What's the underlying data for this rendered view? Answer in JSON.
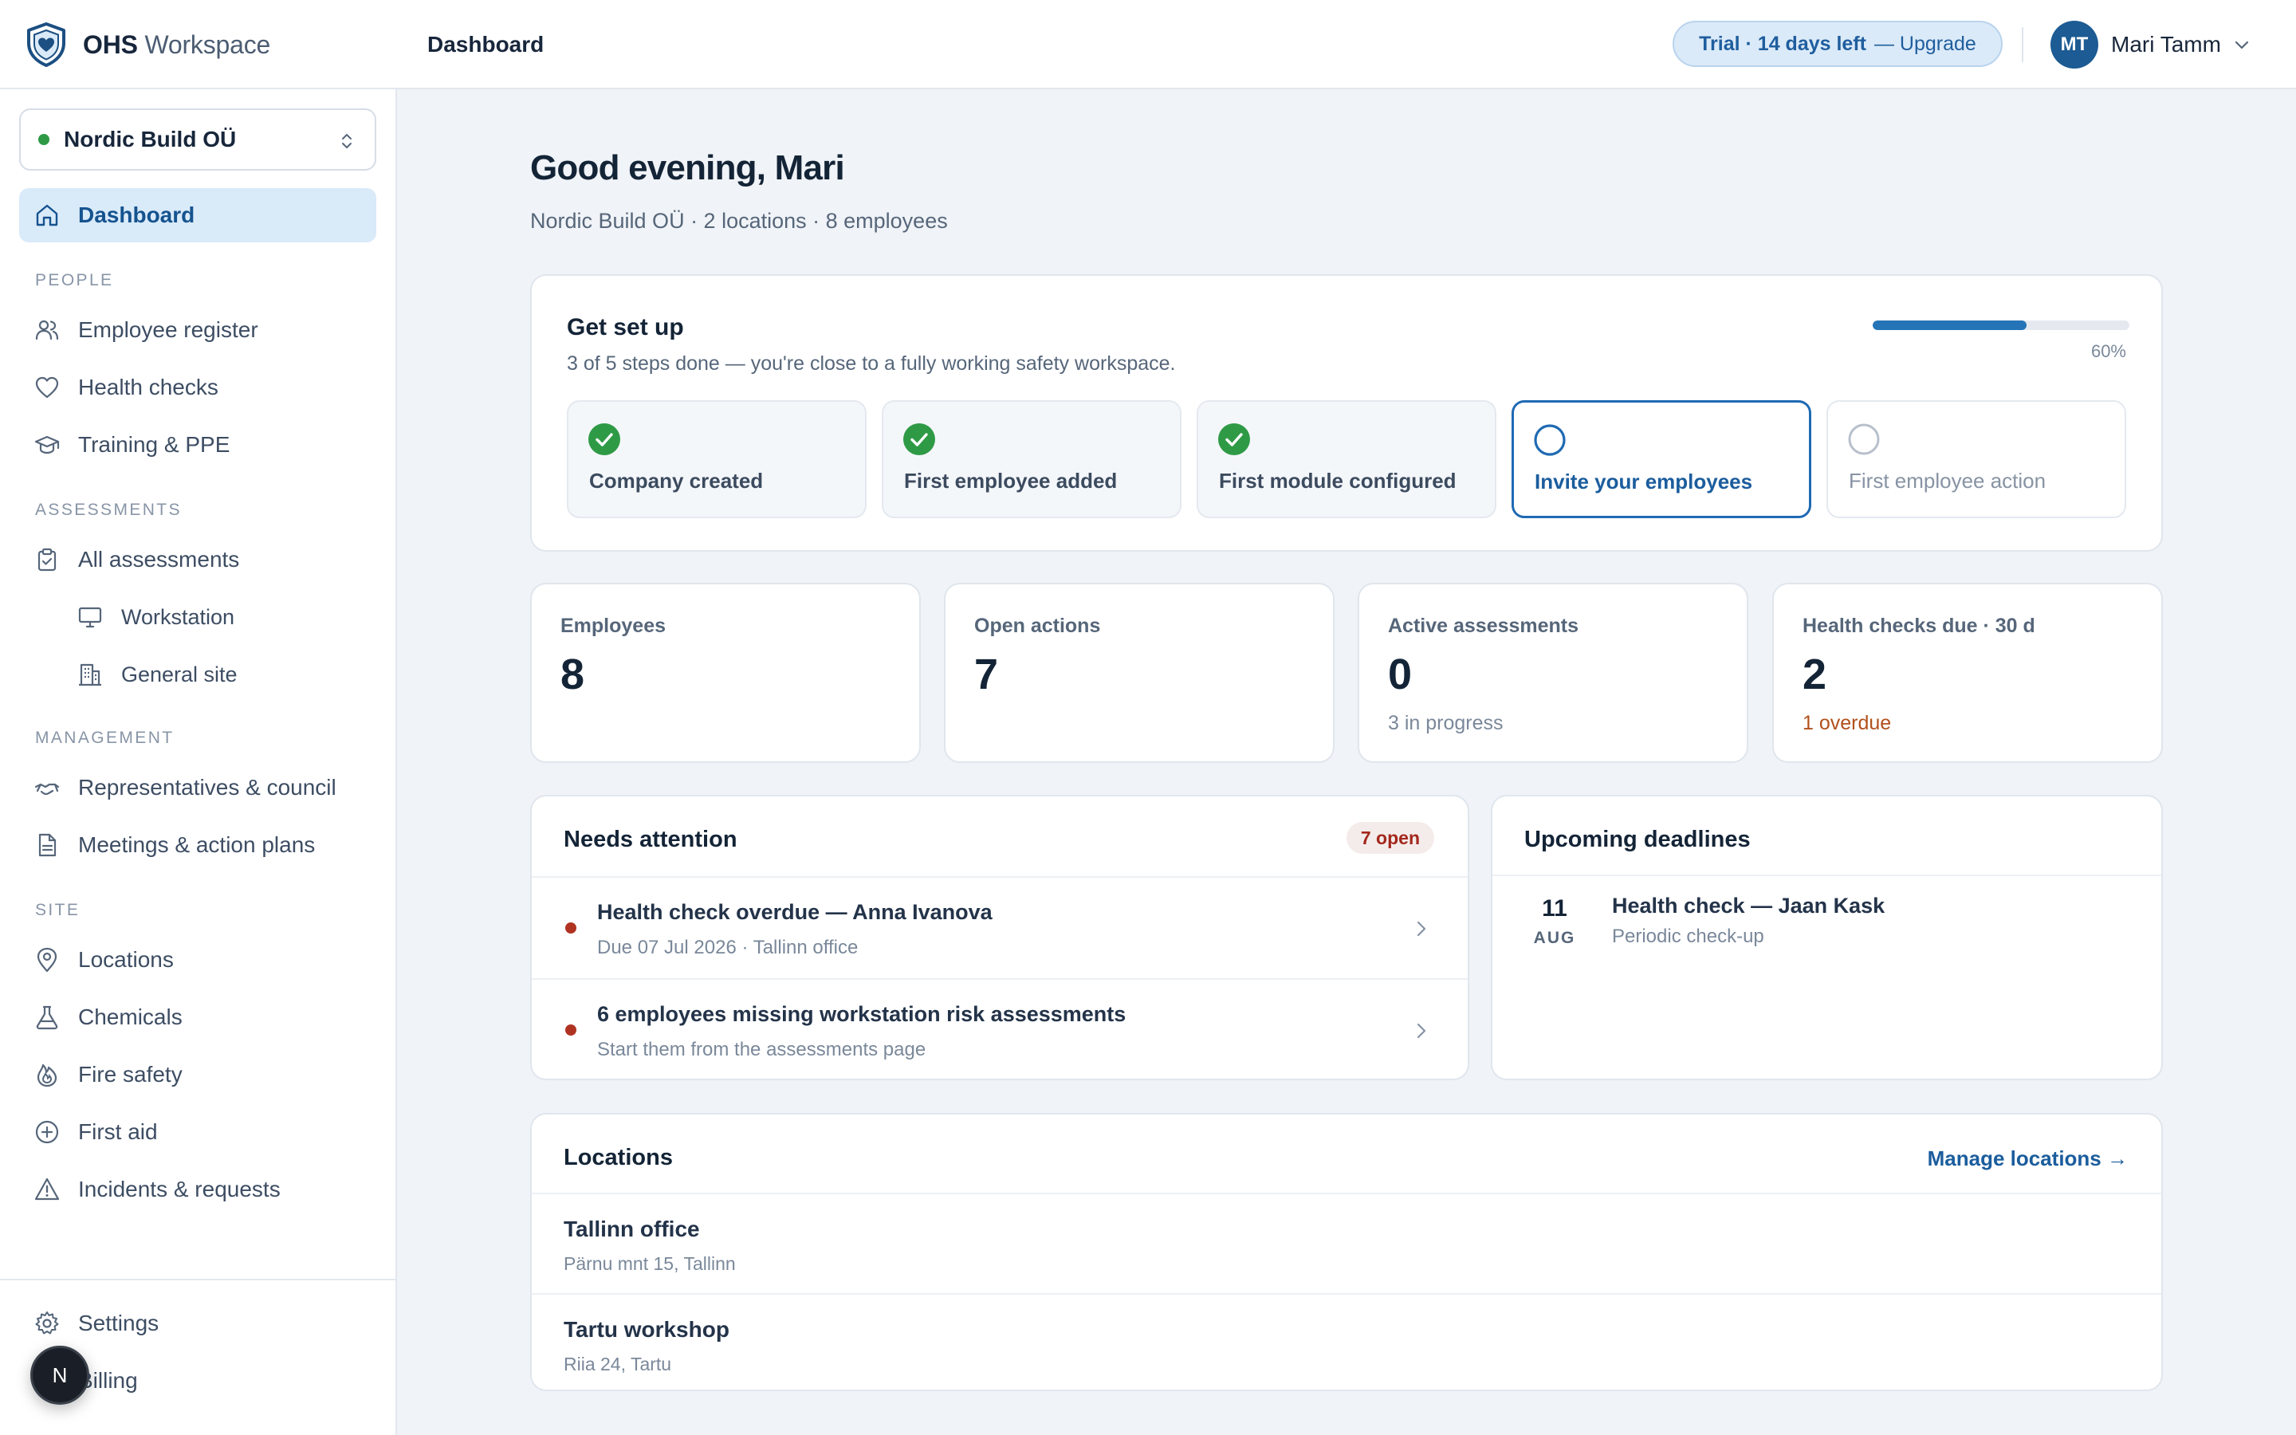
{
  "brand": {
    "name_bold": "OHS",
    "name_light": "Workspace",
    "icon": "shield-heart-icon"
  },
  "topbar": {
    "page_title": "Dashboard",
    "trial_text": "Trial · 14 days left",
    "upgrade_text": "— Upgrade",
    "user_initials": "MT",
    "user_name": "Mari Tamm"
  },
  "sidebar": {
    "org_name": "Nordic Build OÜ",
    "org_status_color": "#2f9a46",
    "dashboard": {
      "label": "Dashboard",
      "icon": "home-icon"
    },
    "sections": {
      "people": "PEOPLE",
      "assessments": "ASSESSMENTS",
      "management": "MANAGEMENT",
      "site": "SITE"
    },
    "people_items": [
      {
        "label": "Employee register",
        "icon": "users-icon"
      },
      {
        "label": "Health checks",
        "icon": "heart-icon"
      },
      {
        "label": "Training & PPE",
        "icon": "graduation-cap-icon"
      }
    ],
    "assessment_items": [
      {
        "label": "All assessments",
        "icon": "clipboard-icon"
      },
      {
        "label": "Workstation",
        "icon": "monitor-icon"
      },
      {
        "label": "General site",
        "icon": "building-icon"
      }
    ],
    "management_items": [
      {
        "label": "Representatives & council",
        "icon": "handshake-icon"
      },
      {
        "label": "Meetings & action plans",
        "icon": "document-icon"
      }
    ],
    "site_items": [
      {
        "label": "Locations",
        "icon": "map-pin-icon"
      },
      {
        "label": "Chemicals",
        "icon": "flask-icon"
      },
      {
        "label": "Fire safety",
        "icon": "flame-icon"
      },
      {
        "label": "First aid",
        "icon": "plus-circle-icon"
      },
      {
        "label": "Incidents & requests",
        "icon": "warning-icon"
      }
    ],
    "footer_items": [
      {
        "label": "Settings",
        "icon": "gear-icon"
      },
      {
        "label": "Billing",
        "icon": "card-icon"
      }
    ],
    "fab_letter": "N"
  },
  "main": {
    "greeting": "Good evening, Mari",
    "subline": "Nordic Build OÜ · 2 locations · 8 employees",
    "setup": {
      "title": "Get set up",
      "subtitle": "3 of 5 steps done — you're close to a fully working safety workspace.",
      "progress": 0.6,
      "progress_label": "60%",
      "steps": [
        {
          "label": "Company created",
          "state": "done"
        },
        {
          "label": "First employee added",
          "state": "done"
        },
        {
          "label": "First module configured",
          "state": "done"
        },
        {
          "label": "Invite your employees",
          "state": "current"
        },
        {
          "label": "First employee action",
          "state": "pending"
        }
      ]
    },
    "stats": [
      {
        "label": "Employees",
        "value": "8",
        "note": ""
      },
      {
        "label": "Open actions",
        "value": "7",
        "note": ""
      },
      {
        "label": "Active assessments",
        "value": "0",
        "note": "3 in progress"
      },
      {
        "label": "Health checks due · 30 d",
        "value": "2",
        "note": "1 overdue"
      }
    ],
    "attention": {
      "title": "Needs attention",
      "badge": "7 open",
      "items": [
        {
          "title": "Health check overdue — Anna Ivanova",
          "sub": "Due 07 Jul 2026 · Tallinn office"
        },
        {
          "title": "6 employees missing workstation risk assessments",
          "sub": "Start them from the assessments page"
        }
      ]
    },
    "deadlines": {
      "title": "Upcoming deadlines",
      "items": [
        {
          "day": "11",
          "month": "AUG",
          "title": "Health check — Jaan Kask",
          "sub": "Periodic check-up"
        }
      ]
    },
    "locations": {
      "title": "Locations",
      "manage_link": "Manage locations →",
      "items": [
        {
          "name": "Tallinn office",
          "address": "Pärnu mnt 15, Tallinn"
        },
        {
          "name": "Tartu workshop",
          "address": "Riia 24, Tartu"
        }
      ]
    }
  },
  "colors": {
    "accent": "#1f6ab3",
    "active_nav_bg": "#d9eaf9",
    "success": "#2f9a46",
    "danger": "#b03322",
    "warning_text": "#b2501c"
  }
}
